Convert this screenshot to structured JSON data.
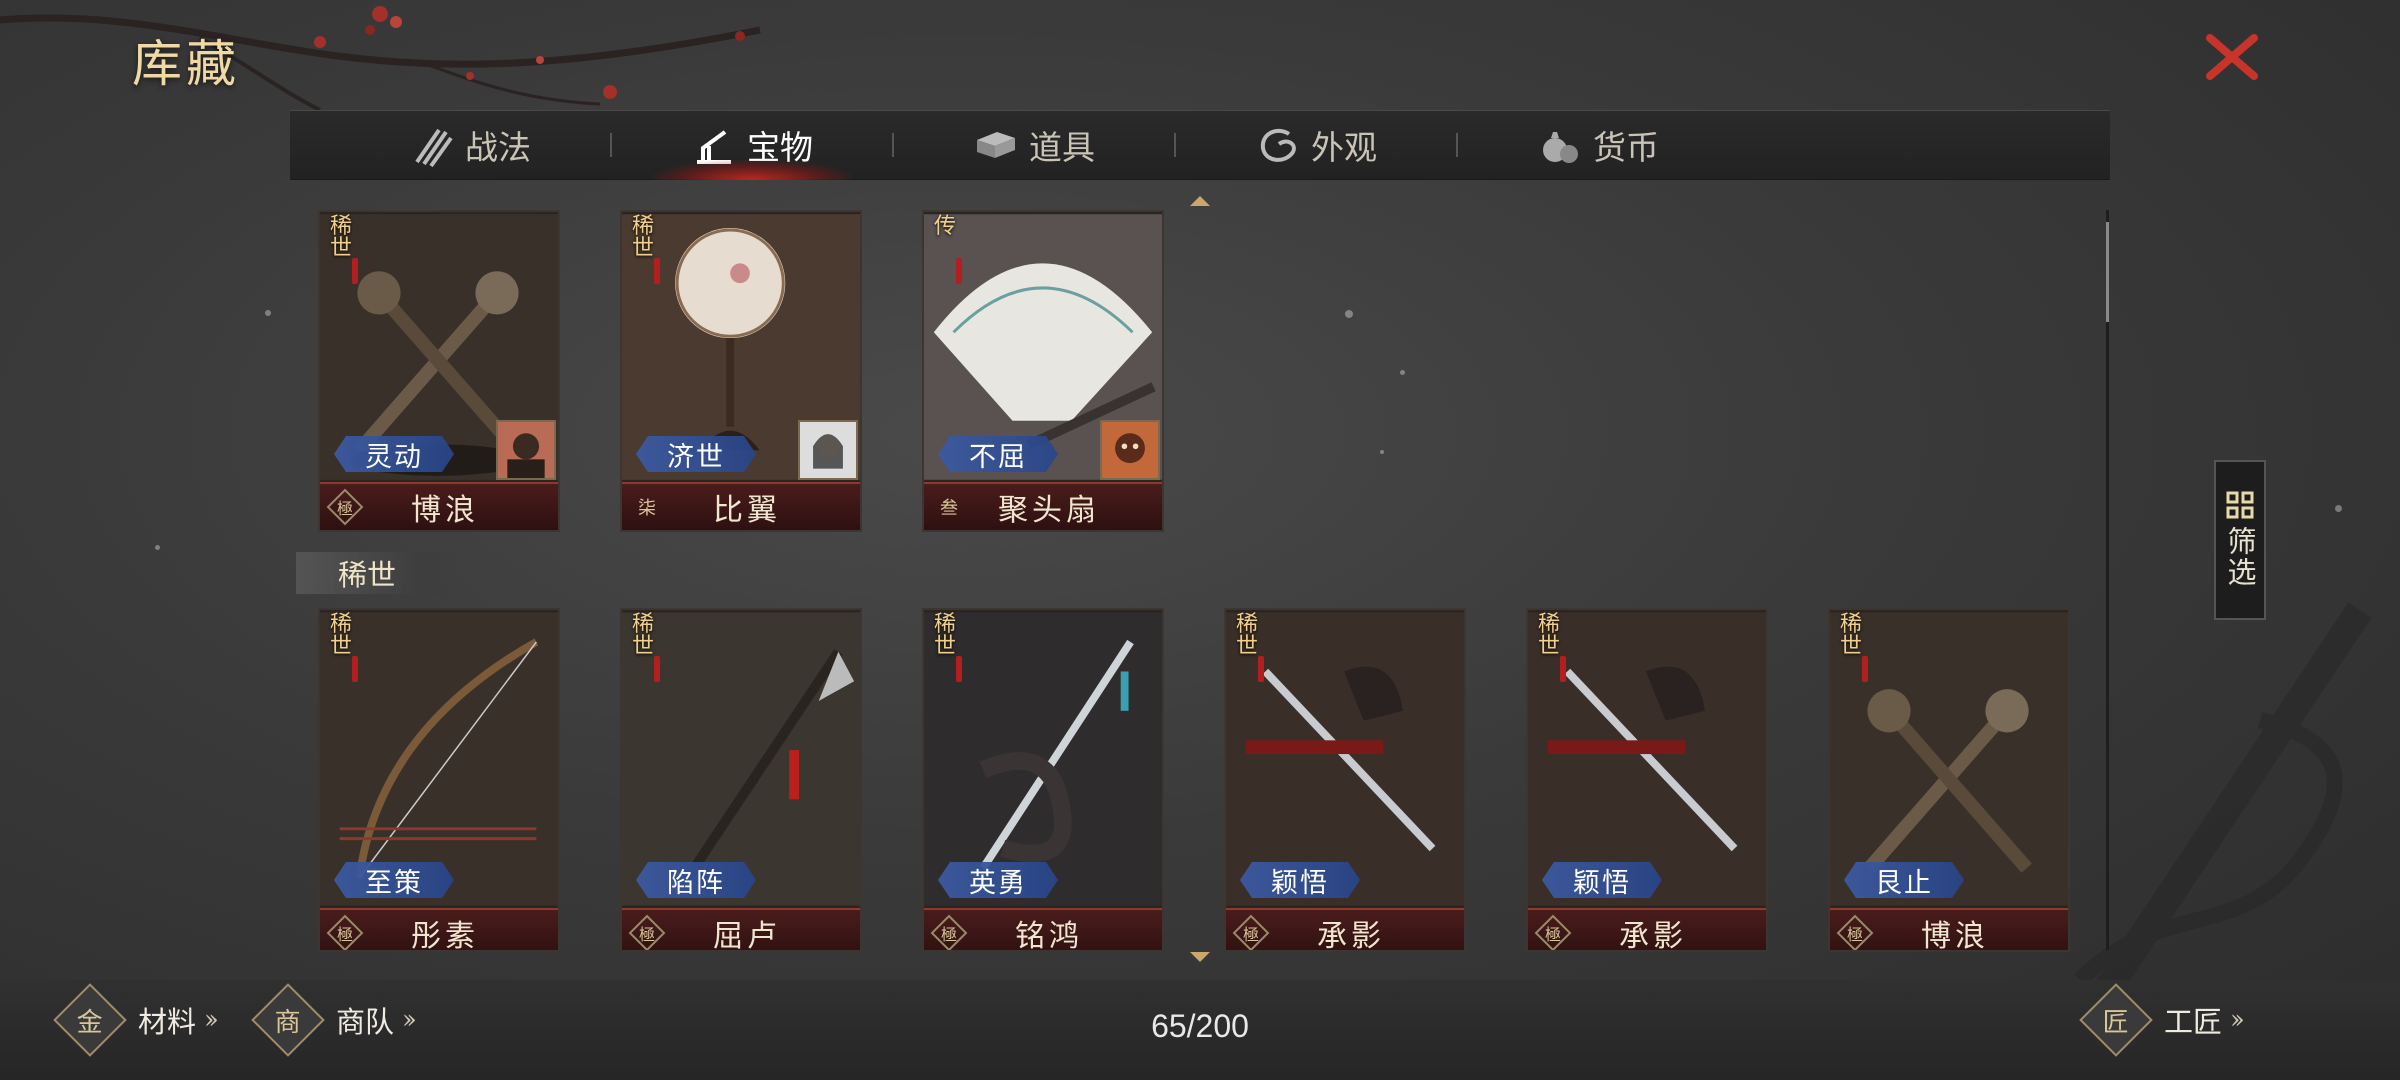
{
  "page": {
    "title": "库藏"
  },
  "tabs": [
    {
      "label": "战法",
      "icon": "bamboo-scroll-icon"
    },
    {
      "label": "宝物",
      "icon": "treasure-stand-icon",
      "active": true
    },
    {
      "label": "道具",
      "icon": "box-icon"
    },
    {
      "label": "外观",
      "icon": "swirl-icon"
    },
    {
      "label": "货币",
      "icon": "money-bag-icon"
    }
  ],
  "featured_cards": [
    {
      "badge": "稀世",
      "skill": "灵动",
      "grade": "極",
      "name": "博浪",
      "has_portrait": true
    },
    {
      "badge": "稀世",
      "skill": "济世",
      "grade": "柒",
      "name": "比翼",
      "has_portrait": true
    },
    {
      "badge": "传",
      "skill": "不屈",
      "grade": "叁",
      "name": "聚头扇",
      "has_portrait": true
    }
  ],
  "section": {
    "label": "稀世"
  },
  "cards": [
    {
      "badge": "稀世",
      "skill": "至策",
      "grade": "極",
      "name": "彤素"
    },
    {
      "badge": "稀世",
      "skill": "陷阵",
      "grade": "極",
      "name": "屈卢"
    },
    {
      "badge": "稀世",
      "skill": "英勇",
      "grade": "極",
      "name": "铭鸿"
    },
    {
      "badge": "稀世",
      "skill": "颖悟",
      "grade": "極",
      "name": "承影"
    },
    {
      "badge": "稀世",
      "skill": "颖悟",
      "grade": "極",
      "name": "承影"
    },
    {
      "badge": "稀世",
      "skill": "艮止",
      "grade": "極",
      "name": "博浪"
    }
  ],
  "filter": {
    "label": "筛选",
    "icon": "grid-icon"
  },
  "bottom": {
    "materials": {
      "label": "材料",
      "icon_char": "金"
    },
    "caravan": {
      "label": "商队",
      "icon_char": "商"
    },
    "craftsman": {
      "label": "工匠",
      "icon_char": "匠"
    },
    "counter": "65/200"
  },
  "colors": {
    "accent_red": "#c0281e",
    "gold": "#f1d9a6",
    "skill_blue": "#3c5aa0"
  }
}
